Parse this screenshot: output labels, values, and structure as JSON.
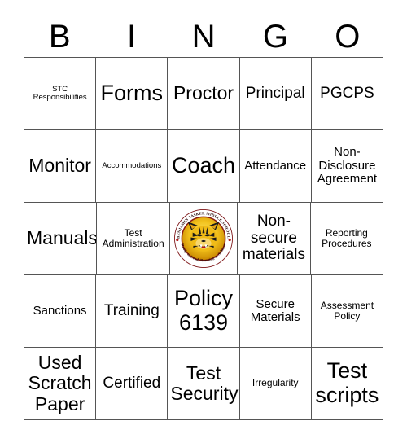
{
  "header": {
    "letters": [
      "B",
      "I",
      "N",
      "G",
      "O"
    ]
  },
  "grid": {
    "rows": [
      [
        {
          "text": "STC Responsibilities",
          "size": "xs"
        },
        {
          "text": "Forms",
          "size": "xxl"
        },
        {
          "text": "Proctor",
          "size": "xl"
        },
        {
          "text": "Principal",
          "size": "lg"
        },
        {
          "text": "PGCPS",
          "size": "lg"
        }
      ],
      [
        {
          "text": "Monitor",
          "size": "xl"
        },
        {
          "text": "Accommodations",
          "size": "xs"
        },
        {
          "text": "Coach",
          "size": "xxl"
        },
        {
          "text": "Attendance",
          "size": "md"
        },
        {
          "text": "Non-Disclosure Agreement",
          "size": "md"
        }
      ],
      [
        {
          "text": "Manuals",
          "size": "xl"
        },
        {
          "text": "Test Administration",
          "size": "sm"
        },
        {
          "text": "",
          "size": "md",
          "logo": true
        },
        {
          "text": "Non-secure materials",
          "size": "lg"
        },
        {
          "text": "Reporting Procedures",
          "size": "sm"
        }
      ],
      [
        {
          "text": "Sanctions",
          "size": "md"
        },
        {
          "text": "Training",
          "size": "lg"
        },
        {
          "text": "Policy 6139",
          "size": "xxl"
        },
        {
          "text": "Secure Materials",
          "size": "md"
        },
        {
          "text": "Assessment Policy",
          "size": "sm"
        }
      ],
      [
        {
          "text": "Used Scratch Paper",
          "size": "xl"
        },
        {
          "text": "Certified",
          "size": "lg"
        },
        {
          "text": "Test Security",
          "size": "xl"
        },
        {
          "text": "Irregularity",
          "size": "sm"
        },
        {
          "text": "Test scripts",
          "size": "xxl"
        }
      ]
    ]
  },
  "logo": {
    "name": "benjamin-tasker-middle-school-tiger-logo",
    "top_arc_text": "BENJAMIN TASKER MIDDLE SCHOOL",
    "bottom_arc_text": "Ready to Lead, Running to Achieve",
    "ring_color": "#7d1416",
    "face_color": "#f0c020",
    "gold_light": "#ffe14d",
    "gold_dark": "#d59200",
    "stripe_color": "#1a1a1a",
    "mouth_color": "#cc1111"
  },
  "colors": {
    "border": "#555555",
    "background": "#ffffff",
    "text": "#000000"
  }
}
